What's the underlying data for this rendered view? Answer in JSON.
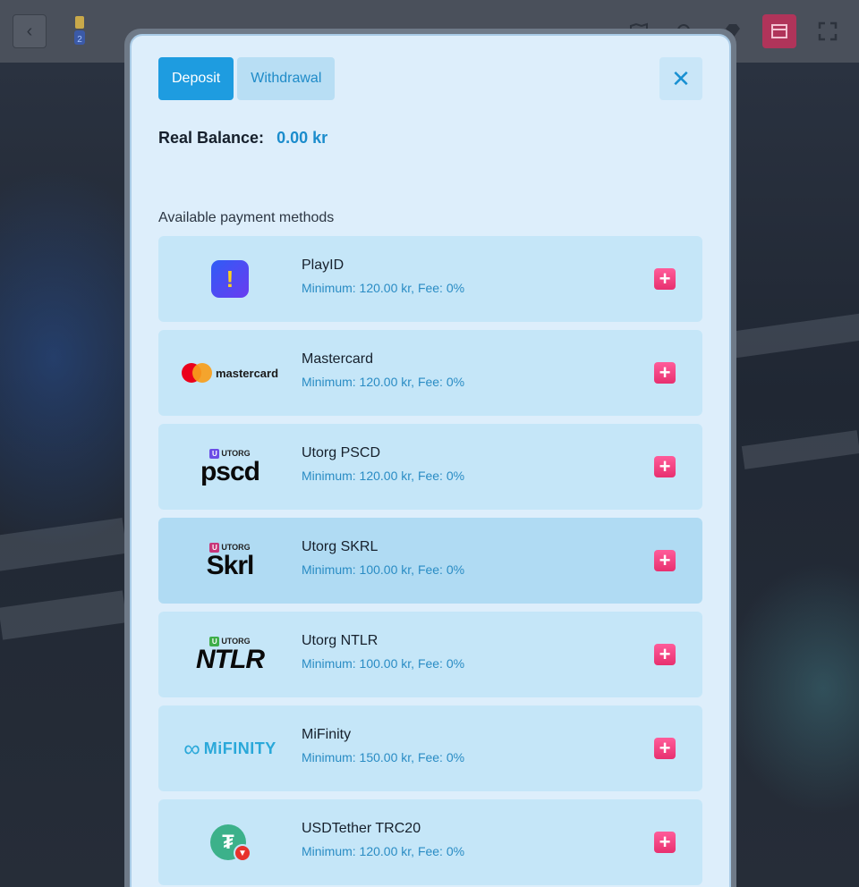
{
  "topbar": {
    "back_icon": "chevron-left-icon",
    "trophy_badge": "2",
    "icons": [
      "map-icon",
      "search-icon",
      "gem-icon",
      "promo-icon",
      "fullscreen-icon"
    ]
  },
  "modal": {
    "tabs": [
      {
        "label": "Deposit",
        "active": true
      },
      {
        "label": "Withdrawal",
        "active": false
      }
    ],
    "close_icon": "close-icon",
    "balance": {
      "label": "Real Balance:",
      "value": "0.00 kr"
    },
    "section_title": "Available payment methods",
    "methods": [
      {
        "name": "PlayID",
        "subtitle": "Minimum: 120.00 kr, Fee: 0%",
        "logo": "playid-logo"
      },
      {
        "name": "Mastercard",
        "subtitle": "Minimum: 120.00 kr, Fee: 0%",
        "logo": "mastercard-logo",
        "logo_text": "mastercard"
      },
      {
        "name": "Utorg PSCD",
        "subtitle": "Minimum: 120.00 kr, Fee: 0%",
        "logo": "utorg-pscd-logo",
        "logo_tag": "UTORG",
        "logo_text": "pscd",
        "logo_u": "U"
      },
      {
        "name": "Utorg SKRL",
        "subtitle": "Minimum: 100.00 kr, Fee: 0%",
        "logo": "utorg-skrl-logo",
        "logo_tag": "UTORG",
        "logo_text": "Skrl",
        "logo_u": "U"
      },
      {
        "name": "Utorg NTLR",
        "subtitle": "Minimum: 100.00 kr, Fee: 0%",
        "logo": "utorg-ntlr-logo",
        "logo_tag": "UTORG",
        "logo_text": "NTLR",
        "logo_u": "U"
      },
      {
        "name": "MiFinity",
        "subtitle": "Minimum: 150.00 kr, Fee: 0%",
        "logo": "mifinity-logo",
        "logo_text": "MiFINITY"
      },
      {
        "name": "USDTether TRC20",
        "subtitle": "Minimum: 120.00 kr, Fee: 0%",
        "logo": "usdt-trc20-logo"
      }
    ]
  },
  "colors": {
    "accent": "#1e9ce0",
    "add_button": "#ee3a78",
    "utorg_pscd": "#6b4de6",
    "utorg_skrl": "#c8367a",
    "utorg_ntlr": "#3fae49"
  }
}
